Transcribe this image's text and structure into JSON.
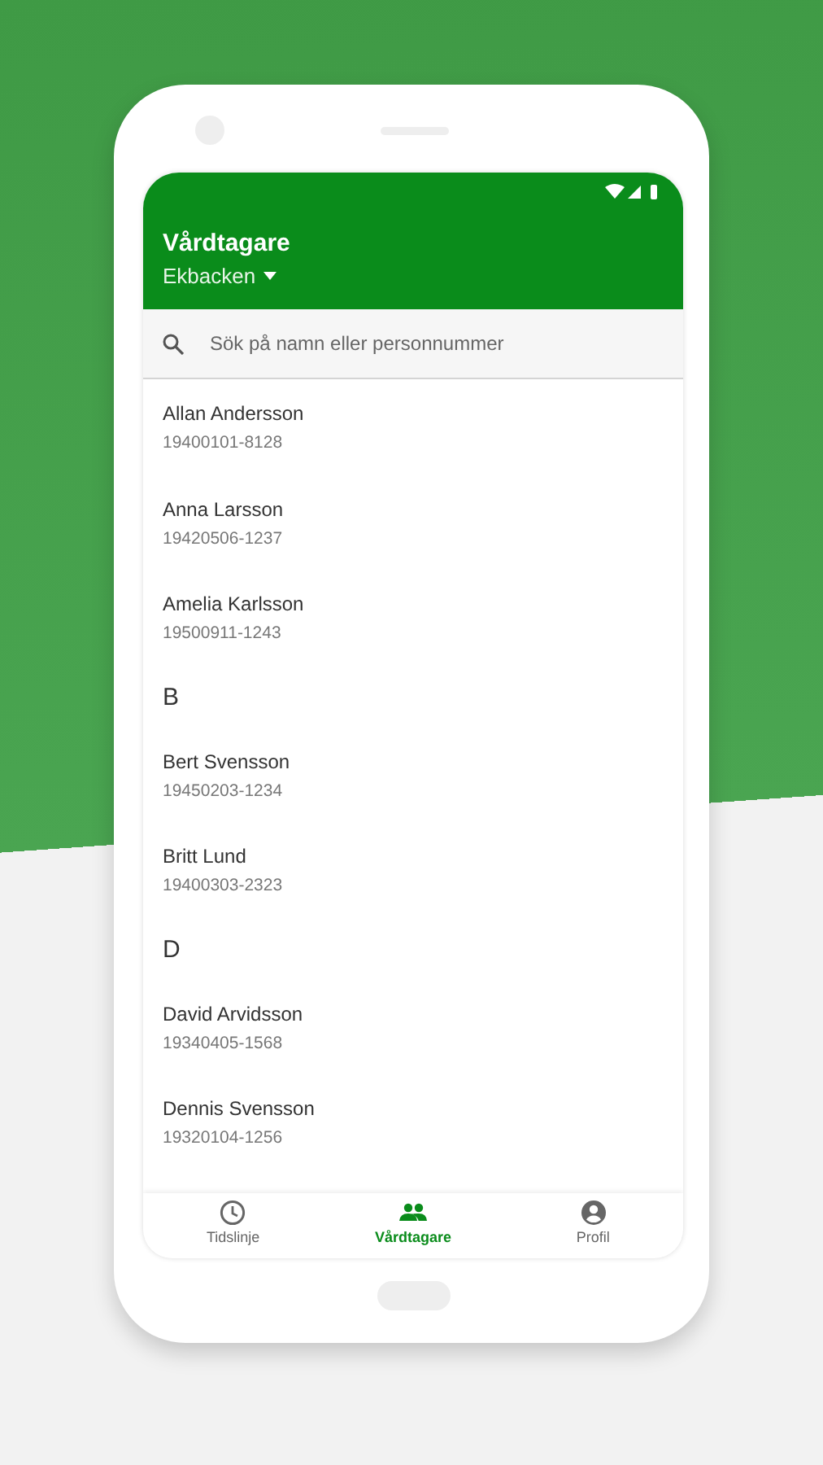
{
  "header": {
    "title": "Vårdtagare",
    "unit": "Ekbacken"
  },
  "search": {
    "placeholder": "Sök på namn eller personnummer"
  },
  "rows": [
    {
      "kind": "patient",
      "name": "Allan Andersson",
      "id": "19400101-8128"
    },
    {
      "kind": "patient",
      "name": "Anna Larsson",
      "id": "19420506-1237"
    },
    {
      "kind": "patient",
      "name": "Amelia Karlsson",
      "id": "19500911-1243"
    },
    {
      "kind": "letter",
      "letter": "B"
    },
    {
      "kind": "patient",
      "name": "Bert Svensson",
      "id": "19450203-1234"
    },
    {
      "kind": "patient",
      "name": "Britt Lund",
      "id": "19400303-2323"
    },
    {
      "kind": "letter",
      "letter": "D"
    },
    {
      "kind": "patient",
      "name": "David Arvidsson",
      "id": "19340405-1568"
    },
    {
      "kind": "patient",
      "name": "Dennis Svensson",
      "id": "19320104-1256"
    }
  ],
  "nav": [
    {
      "kind": "timeline",
      "label": "Tidslinje",
      "selected": false
    },
    {
      "kind": "clients",
      "label": "Vårdtagare",
      "selected": true
    },
    {
      "kind": "profile",
      "label": "Profil",
      "selected": false
    }
  ]
}
